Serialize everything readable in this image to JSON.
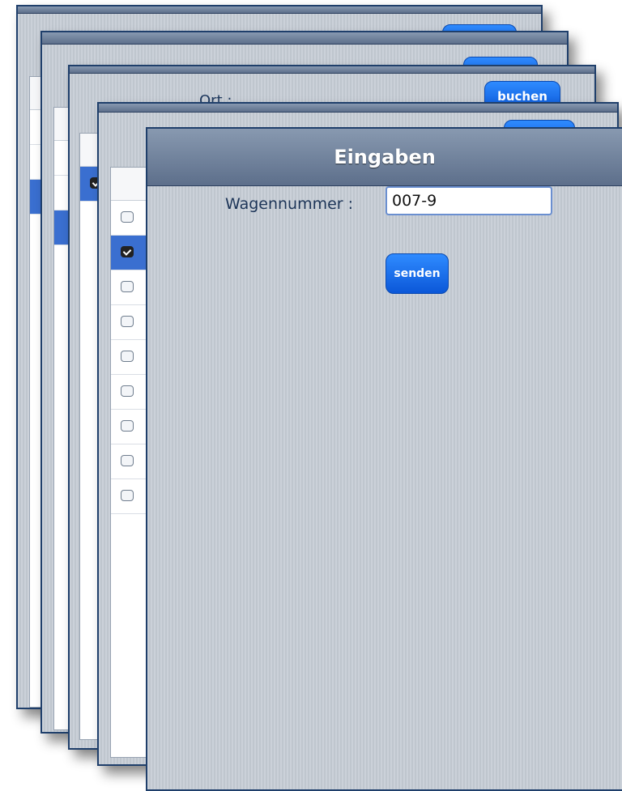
{
  "background_cards": {
    "card1": {
      "button_label": ""
    },
    "card2": {
      "button_label": ""
    },
    "card3": {
      "label": "Ort :",
      "button_label": "buchen"
    },
    "card4": {
      "button_label": ""
    }
  },
  "list": {
    "rows": [
      {
        "checked": false,
        "selected": false
      },
      {
        "checked": true,
        "selected": true
      },
      {
        "checked": false,
        "selected": false
      },
      {
        "checked": false,
        "selected": false
      },
      {
        "checked": false,
        "selected": false
      },
      {
        "checked": false,
        "selected": false
      },
      {
        "checked": false,
        "selected": false
      },
      {
        "checked": false,
        "selected": false
      },
      {
        "checked": false,
        "selected": false
      }
    ]
  },
  "front_card": {
    "title": "Eingaben",
    "wagennummer_label": "Wagennummer :",
    "wagennummer_value": "007-9",
    "send_button_label": "senden"
  },
  "colors": {
    "accent_blue": "#0b57d8",
    "selected_row": "#3a6fd0",
    "frame_border": "#1f3f6b"
  }
}
